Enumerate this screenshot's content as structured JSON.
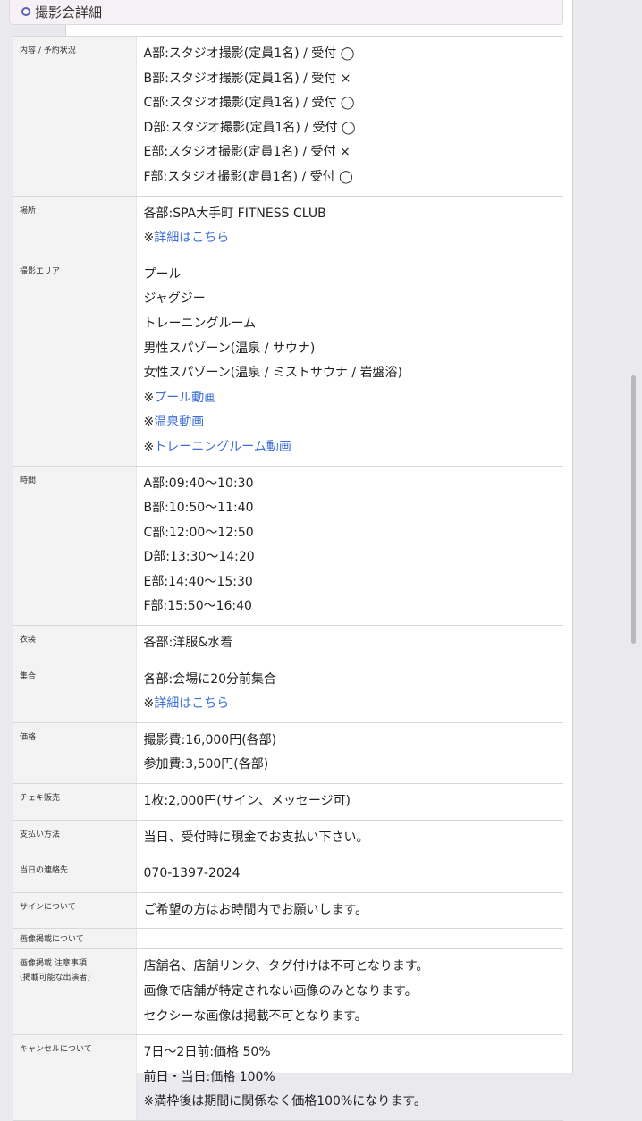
{
  "section": {
    "title": "撮影会詳細"
  },
  "rows": [
    {
      "label": "内容 / 予約状況",
      "lines": [
        {
          "text": "A部:スタジオ撮影(定員1名) / 受付 ◯"
        },
        {
          "text": "B部:スタジオ撮影(定員1名) / 受付 ×"
        },
        {
          "text": "C部:スタジオ撮影(定員1名) / 受付 ◯"
        },
        {
          "text": "D部:スタジオ撮影(定員1名) / 受付 ◯"
        },
        {
          "text": "E部:スタジオ撮影(定員1名) / 受付 ×"
        },
        {
          "text": "F部:スタジオ撮影(定員1名) / 受付 ◯"
        }
      ]
    },
    {
      "label": "場所",
      "lines": [
        {
          "text": "各部:SPA大手町 FITNESS CLUB"
        },
        {
          "prefix": "※",
          "link": "詳細はこちら"
        }
      ]
    },
    {
      "label": "撮影エリア",
      "lines": [
        {
          "text": "プール"
        },
        {
          "text": "ジャグジー"
        },
        {
          "text": "トレーニングルーム"
        },
        {
          "text": "男性スパゾーン(温泉 / サウナ)"
        },
        {
          "text": "女性スパゾーン(温泉 / ミストサウナ / 岩盤浴)"
        },
        {
          "prefix": "※",
          "link": "プール動画"
        },
        {
          "prefix": "※",
          "link": "温泉動画"
        },
        {
          "prefix": "※",
          "link": "トレーニングルーム動画"
        }
      ]
    },
    {
      "label": "時間",
      "lines": [
        {
          "text": "A部:09:40〜10:30"
        },
        {
          "text": "B部:10:50〜11:40"
        },
        {
          "text": "C部:12:00〜12:50"
        },
        {
          "text": "D部:13:30〜14:20"
        },
        {
          "text": "E部:14:40〜15:30"
        },
        {
          "text": "F部:15:50〜16:40"
        }
      ]
    },
    {
      "label": "衣装",
      "lines": [
        {
          "text": "各部:洋服&水着"
        }
      ]
    },
    {
      "label": "集合",
      "lines": [
        {
          "text": "各部:会場に20分前集合"
        },
        {
          "prefix": "※",
          "link": "詳細はこちら"
        }
      ]
    },
    {
      "label": "価格",
      "lines": [
        {
          "text": "撮影費:16,000円(各部)"
        },
        {
          "text": "参加費:3,500円(各部)"
        }
      ]
    },
    {
      "label": "チェキ販売",
      "lines": [
        {
          "text": "1枚:2,000円(サイン、メッセージ可)"
        }
      ]
    },
    {
      "label": "支払い方法",
      "lines": [
        {
          "text": "当日、受付時に現金でお支払い下さい。"
        }
      ]
    },
    {
      "label": "当日の連絡先",
      "lines": [
        {
          "text": "070-1397-2024"
        }
      ]
    },
    {
      "label": "サインについて",
      "lines": [
        {
          "text": "ご希望の方はお時間内でお願いします。"
        }
      ]
    },
    {
      "label": "画像掲載について",
      "lines": []
    },
    {
      "label": "画像掲載 注意事項",
      "label2": "(掲載可能な出演者)",
      "lines": [
        {
          "text": "店舗名、店舗リンク、タグ付けは不可となります。"
        },
        {
          "text": "画像で店舗が特定されない画像のみとなります。"
        },
        {
          "text": "セクシーな画像は掲載不可となります。"
        }
      ]
    },
    {
      "label": "キャンセルについて",
      "lines": [
        {
          "text": "7日〜2日前:価格 50%"
        },
        {
          "text": "前日・当日:価格 100%"
        },
        {
          "text": "※満枠後は期間に関係なく価格100%になります。"
        }
      ]
    }
  ]
}
